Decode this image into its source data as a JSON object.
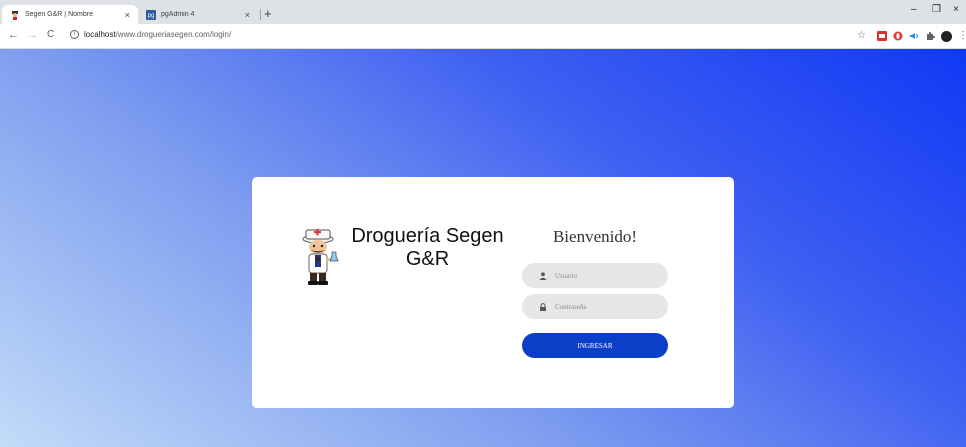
{
  "browser": {
    "tabs": [
      {
        "title": "Segen G&R | Nombre",
        "active": true
      },
      {
        "title": "pgAdmin 4",
        "active": false
      }
    ],
    "new_tab": "+",
    "tab_close": "×",
    "window_controls": {
      "minimize": "–",
      "maximize": "❐",
      "close": "×"
    },
    "nav": {
      "back": "←",
      "forward": "→",
      "reload": "C"
    },
    "url": {
      "host": "localhost",
      "path": "/www.drogueriasegen.com/login/"
    },
    "bookmark_star": "☆"
  },
  "login": {
    "brand_line1": "Droguería Segen",
    "brand_line2": "G&R",
    "welcome": "Bienvenido!",
    "username_placeholder": "Usuario",
    "password_placeholder": "Contraseña",
    "submit_label": "INGRESAR"
  },
  "colors": {
    "gradient_light": "#c2dcf8",
    "gradient_dark": "#1039f5",
    "button": "#0b3fc8",
    "field_bg": "#e6e6e6"
  }
}
